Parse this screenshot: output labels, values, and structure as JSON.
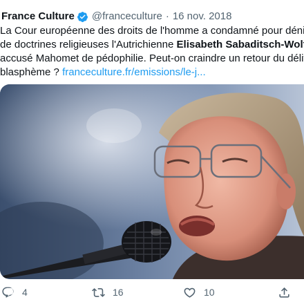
{
  "tweet": {
    "author_name": "France Culture",
    "handle": "@franceculture",
    "separator": "·",
    "date": "16 nov. 2018",
    "text": {
      "line1": "La Cour européenne des droits de l'homme a condamné pour dénig",
      "line2_a": "de doctrines religieuses l'Autrichienne ",
      "line2_b": "Elisabeth Sabaditsch-Wolff",
      "line3": "accusé Mahomet de pédophilie. Peut-on craindre un retour du délit",
      "line4_a": "blasphème ? ",
      "line4_link": "franceculture.fr/emissions/le-j..."
    },
    "actions": {
      "reply_count": "4",
      "retweet_count": "16",
      "like_count": "10"
    },
    "icons": {
      "verified": "verified-badge-icon",
      "reply": "reply-icon",
      "retweet": "retweet-icon",
      "like": "heart-icon",
      "share": "share-icon"
    },
    "colors": {
      "link": "#1d9bf0",
      "verified": "#1d9bf0",
      "secondary_text": "#536471"
    }
  }
}
